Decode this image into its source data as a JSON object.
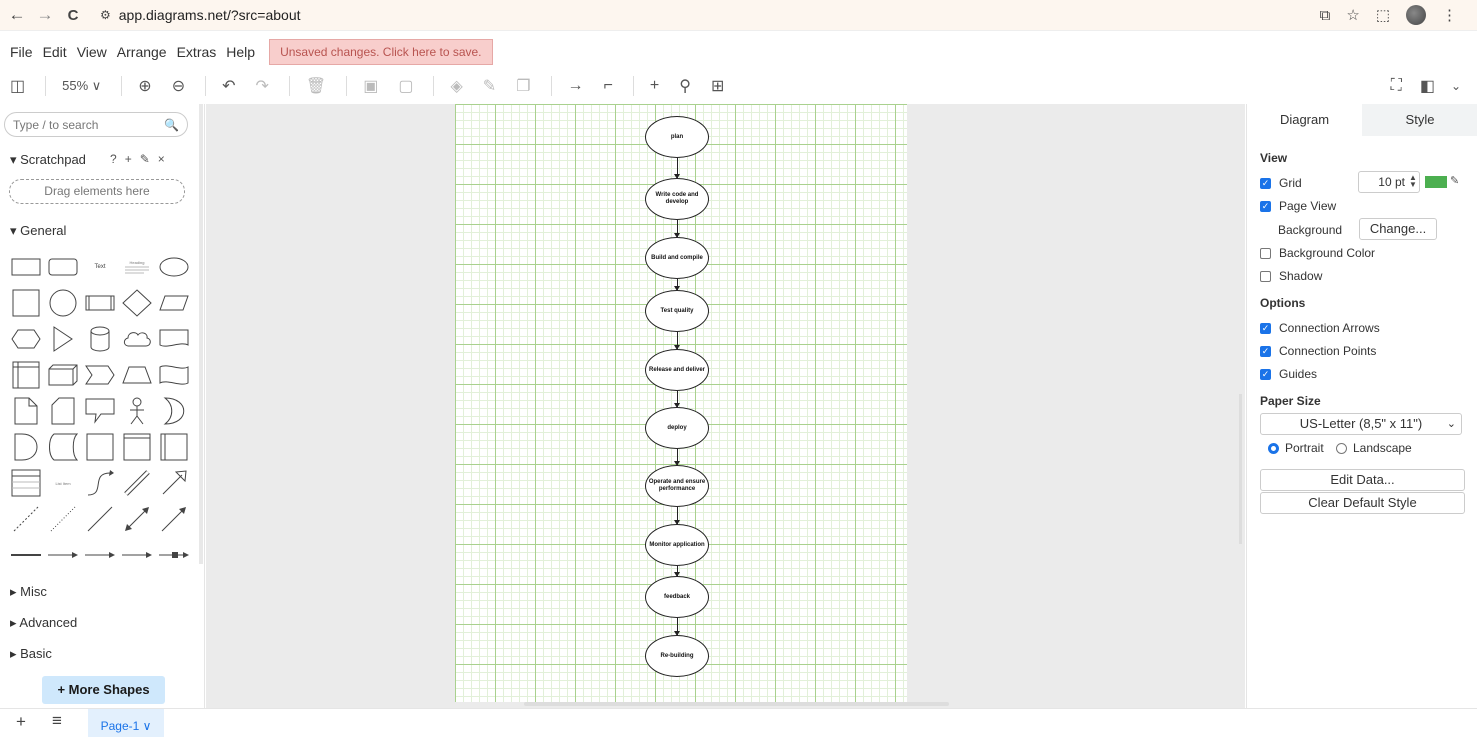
{
  "browser": {
    "url": "app.diagrams.net/?src=about",
    "back": "←",
    "forward": "→",
    "reload": "C"
  },
  "menu": {
    "items": [
      "File",
      "Edit",
      "View",
      "Arrange",
      "Extras",
      "Help"
    ],
    "unsaved": "Unsaved changes. Click here to save."
  },
  "toolbar": {
    "zoom": "55% ∨"
  },
  "sidebar": {
    "search_placeholder": "Type / to search",
    "scratchpad": "Scratchpad",
    "drag_hint": "Drag elements here",
    "general": "General",
    "sections": [
      "Misc",
      "Advanced",
      "Basic"
    ],
    "more_shapes": "+ More Shapes",
    "text_shape": "Text",
    "heading_shape": "Heading",
    "list_item_shape": "List Item"
  },
  "diagram": {
    "nodes": [
      "plan",
      "Write code and develop",
      "Build and compile",
      "Test quality",
      "Release and deliver",
      "deploy",
      "Operate and ensure performance",
      "Monitor application",
      "feedback",
      "Re-building"
    ]
  },
  "format": {
    "tabs": [
      "Diagram",
      "Style"
    ],
    "view_heading": "View",
    "grid": "Grid",
    "grid_size": "10 pt",
    "grid_color": "#4caf50",
    "page_view": "Page View",
    "background": "Background",
    "change": "Change...",
    "background_color": "Background Color",
    "shadow": "Shadow",
    "options_heading": "Options",
    "connection_arrows": "Connection Arrows",
    "connection_points": "Connection Points",
    "guides": "Guides",
    "paper_size_heading": "Paper Size",
    "paper_size": "US-Letter (8,5\" x 11\")",
    "portrait": "Portrait",
    "landscape": "Landscape",
    "edit_data": "Edit Data...",
    "clear_default_style": "Clear Default Style"
  },
  "pages": {
    "add": "+",
    "menu": "≡",
    "current": "Page-1 ∨"
  }
}
